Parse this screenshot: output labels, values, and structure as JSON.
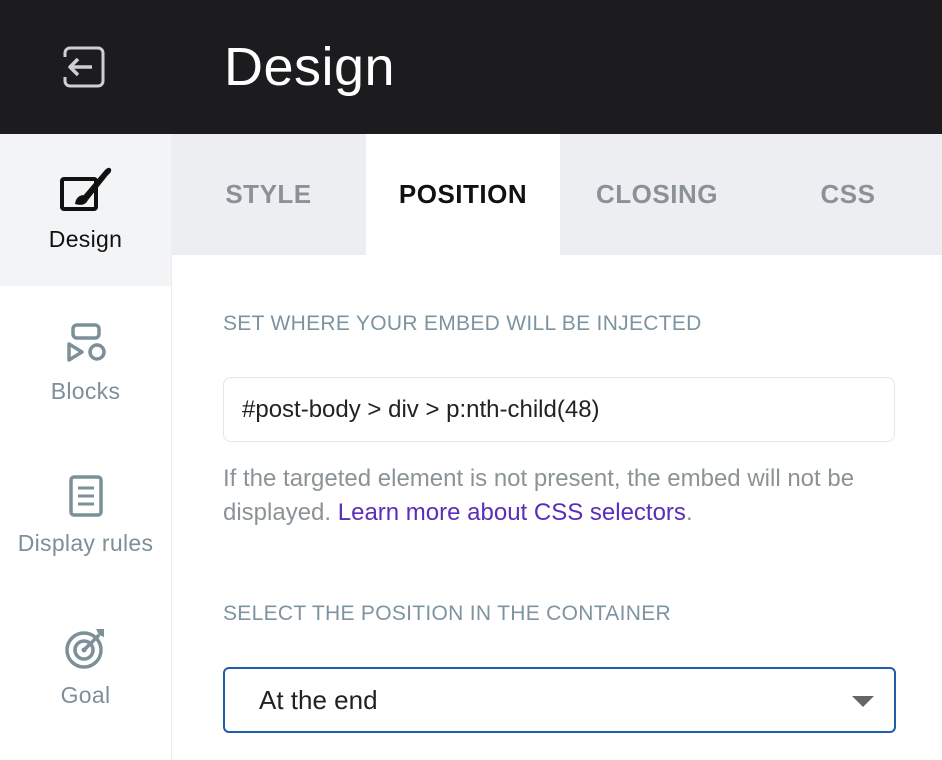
{
  "header": {
    "title": "Design",
    "back_icon": "exit-icon"
  },
  "sidebar": {
    "items": [
      {
        "label": "Design",
        "icon": "paintbrush-icon",
        "active": true
      },
      {
        "label": "Blocks",
        "icon": "blocks-icon",
        "active": false
      },
      {
        "label": "Display rules",
        "icon": "list-icon",
        "active": false
      },
      {
        "label": "Goal",
        "icon": "target-icon",
        "active": false
      }
    ]
  },
  "tabs": [
    {
      "label": "STYLE",
      "active": false
    },
    {
      "label": "POSITION",
      "active": true
    },
    {
      "label": "CLOSING",
      "active": false
    },
    {
      "label": "CSS",
      "active": false
    }
  ],
  "position": {
    "inject_label": "SET WHERE YOUR EMBED WILL BE INJECTED",
    "selector_value": "#post-body > div > p:nth-child(48)",
    "help_text": "If the targeted element is not present, the embed will not be displayed. ",
    "help_link": "Learn more about CSS selectors",
    "help_end": ".",
    "container_label": "SELECT THE POSITION IN THE CONTAINER",
    "container_value": "At the end"
  },
  "colors": {
    "topbar": "#1c1c1f",
    "accent_link": "#5b2dba",
    "focus_border": "#1d5fa8"
  }
}
